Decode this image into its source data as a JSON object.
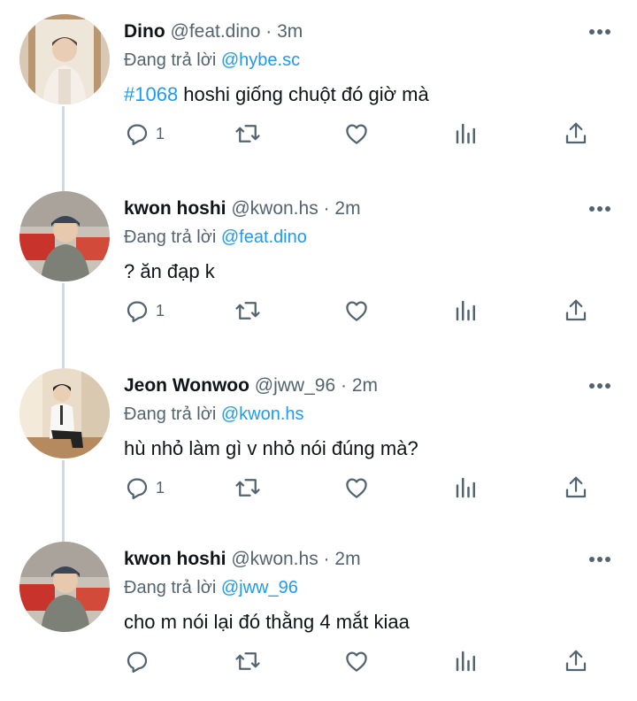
{
  "tweets": [
    {
      "name": "Dino",
      "handle": "@feat.dino",
      "dot": "·",
      "time": "3m",
      "replying_prefix": "Đang trả lời",
      "replying_to": "@hybe.sc",
      "hashtag": "#1068",
      "text": " hoshi giống chuột đó giờ mà",
      "reply_count": "1"
    },
    {
      "name": "kwon hoshi",
      "handle": "@kwon.hs",
      "dot": "·",
      "time": "2m",
      "replying_prefix": "Đang trả lời",
      "replying_to": "@feat.dino",
      "hashtag": "",
      "text": "? ăn đạp k",
      "reply_count": "1"
    },
    {
      "name": "Jeon Wonwoo",
      "handle": "@jww_96",
      "dot": "·",
      "time": "2m",
      "replying_prefix": "Đang trả lời",
      "replying_to": "@kwon.hs",
      "hashtag": "",
      "text": "hù nhỏ làm gì v nhỏ nói đúng mà?",
      "reply_count": "1"
    },
    {
      "name": "kwon hoshi",
      "handle": "@kwon.hs",
      "dot": "·",
      "time": "2m",
      "replying_prefix": "Đang trả lời",
      "replying_to": "@jww_96",
      "hashtag": "",
      "text": "cho m nói lại đó thằng 4 mắt kiaa",
      "reply_count": ""
    }
  ],
  "icons": {
    "reply": "reply-icon",
    "retweet": "retweet-icon",
    "like": "heart-icon",
    "views": "views-icon",
    "share": "share-icon",
    "more": "more-icon"
  },
  "colors": {
    "link": "#1d9bf0",
    "secondary": "#536471",
    "text": "#0f1419",
    "thread_line": "#cfd9de"
  }
}
